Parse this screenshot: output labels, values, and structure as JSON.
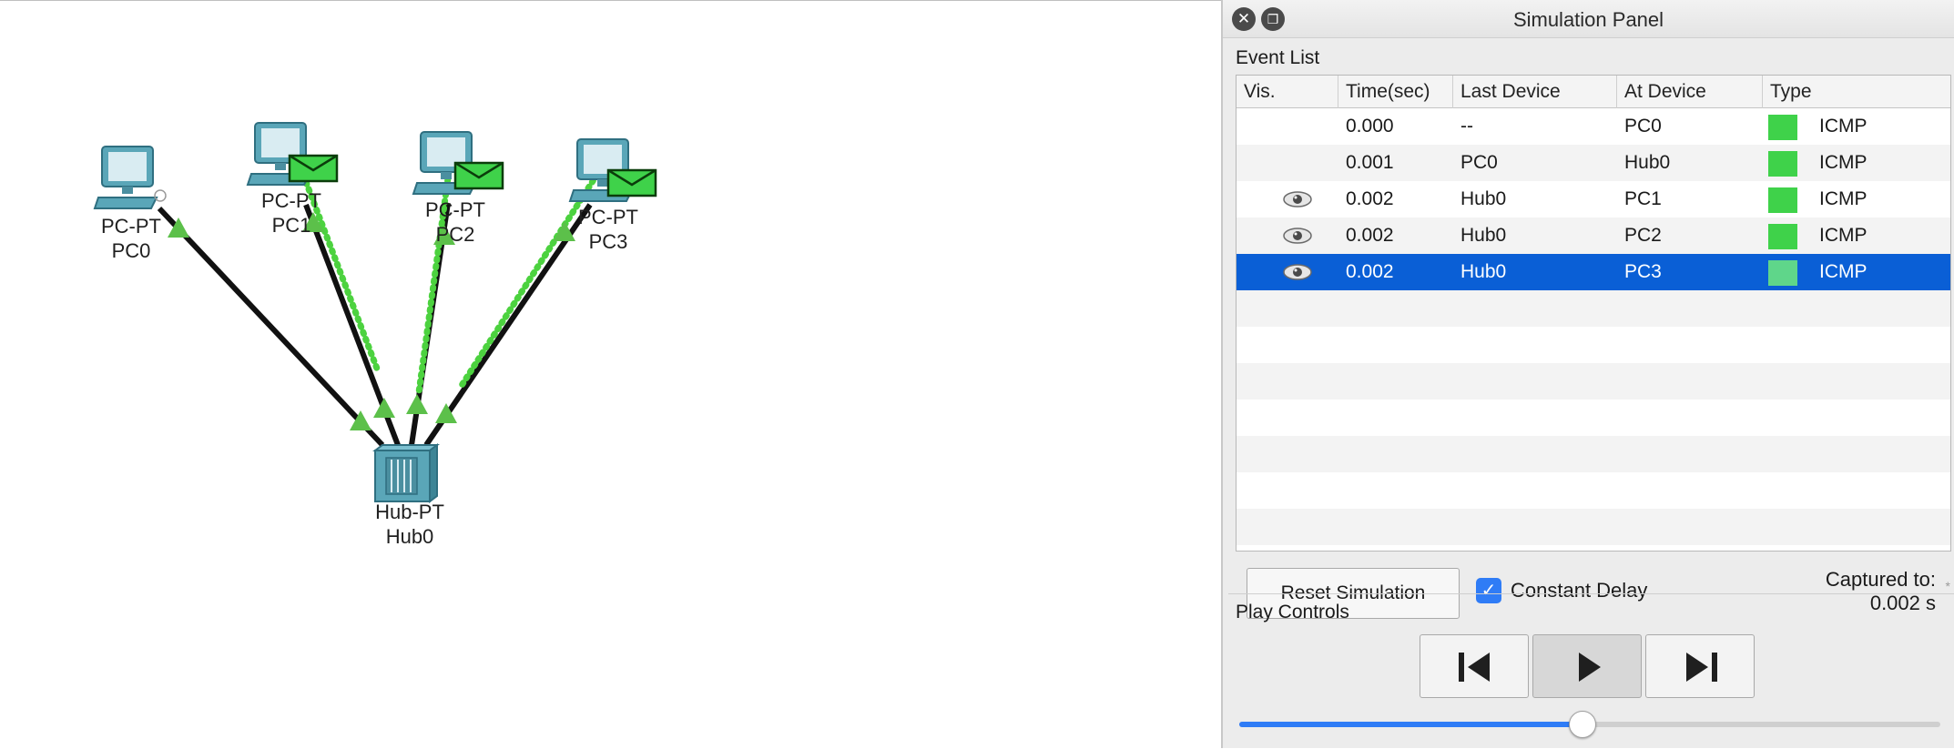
{
  "topology": {
    "devices": [
      {
        "id": "pc0",
        "model": "PC-PT",
        "name": "PC0"
      },
      {
        "id": "pc1",
        "model": "PC-PT",
        "name": "PC1"
      },
      {
        "id": "pc2",
        "model": "PC-PT",
        "name": "PC2"
      },
      {
        "id": "pc3",
        "model": "PC-PT",
        "name": "PC3"
      },
      {
        "id": "hub0",
        "model": "Hub-PT",
        "name": "Hub0"
      }
    ],
    "packets_in_transit": [
      "PC1",
      "PC2",
      "PC3"
    ]
  },
  "panel": {
    "title": "Simulation Panel",
    "event_list_label": "Event List",
    "columns": [
      "Vis.",
      "Time(sec)",
      "Last Device",
      "At Device",
      "Type"
    ],
    "events": [
      {
        "visible": false,
        "time": "0.000",
        "last": "--",
        "at": "PC0",
        "type": "ICMP",
        "color": "#3fd24a",
        "selected": false
      },
      {
        "visible": false,
        "time": "0.001",
        "last": "PC0",
        "at": "Hub0",
        "type": "ICMP",
        "color": "#3fd24a",
        "selected": false
      },
      {
        "visible": true,
        "time": "0.002",
        "last": "Hub0",
        "at": "PC1",
        "type": "ICMP",
        "color": "#3fd24a",
        "selected": false
      },
      {
        "visible": true,
        "time": "0.002",
        "last": "Hub0",
        "at": "PC2",
        "type": "ICMP",
        "color": "#3fd24a",
        "selected": false
      },
      {
        "visible": true,
        "time": "0.002",
        "last": "Hub0",
        "at": "PC3",
        "type": "ICMP",
        "color": "#5fd68a",
        "selected": true
      }
    ],
    "reset_label": "Reset Simulation",
    "constant_delay_label": "Constant Delay",
    "constant_delay_checked": true,
    "captured_label": "Captured to:",
    "captured_value": "0.002 s",
    "play_controls_label": "Play Controls",
    "speed_level": 0.49
  },
  "colors": {
    "accent": "#0a5fd6",
    "packet_green": "#3fd24a",
    "link_dots": "#4cd23f"
  }
}
